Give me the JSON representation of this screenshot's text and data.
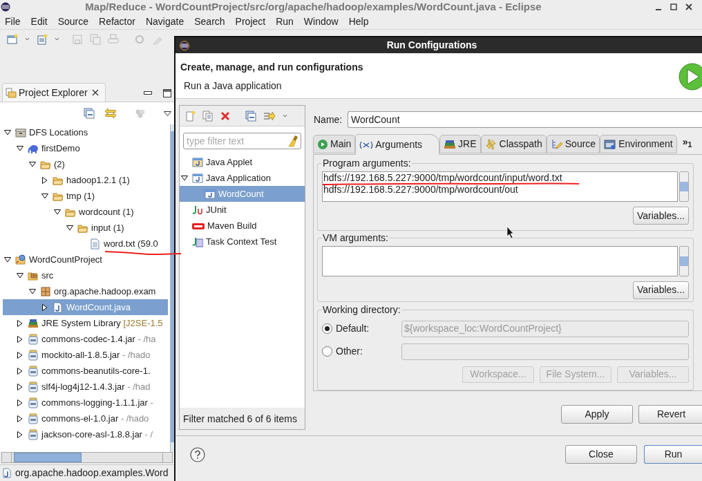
{
  "window": {
    "title": "Map/Reduce - WordCountProject/src/org/apache/hadoop/examples/WordCount.java - Eclipse"
  },
  "menu": [
    "File",
    "Edit",
    "Source",
    "Refactor",
    "Navigate",
    "Search",
    "Project",
    "Run",
    "Window",
    "Help"
  ],
  "project_explorer": {
    "title": "Project Explorer",
    "tree": [
      {
        "label": "DFS Locations",
        "kind": "dfs",
        "expanded": true,
        "selected": false,
        "children": [
          {
            "label": "firstDemo",
            "kind": "hadoop",
            "expanded": true,
            "selected": false,
            "children": [
              {
                "label": "(2)",
                "kind": "folder",
                "expanded": true,
                "selected": false,
                "children": [
                  {
                    "label": "hadoop1.2.1 (1)",
                    "kind": "folder",
                    "expanded": false,
                    "selected": false
                  },
                  {
                    "label": "tmp (1)",
                    "kind": "folder",
                    "expanded": true,
                    "selected": false,
                    "children": [
                      {
                        "label": "wordcount (1)",
                        "kind": "folder",
                        "expanded": true,
                        "selected": false,
                        "children": [
                          {
                            "label": "input (1)",
                            "kind": "folder",
                            "expanded": true,
                            "selected": false,
                            "children": [
                              {
                                "label": "word.txt (59.0",
                                "kind": "file",
                                "selected": false
                              }
                            ]
                          }
                        ]
                      }
                    ]
                  }
                ]
              }
            ]
          }
        ]
      },
      {
        "label": "WordCountProject",
        "kind": "project",
        "expanded": true,
        "selected": false,
        "children": [
          {
            "label": "src",
            "kind": "source-folder",
            "expanded": true,
            "selected": false,
            "children": [
              {
                "label": "org.apache.hadoop.exam",
                "kind": "package",
                "expanded": true,
                "selected": false,
                "children": [
                  {
                    "label": "WordCount.java",
                    "kind": "java",
                    "expanded": false,
                    "selected": true
                  }
                ]
              }
            ]
          },
          {
            "label": "JRE System Library",
            "suffix": " [J2SE-1.5",
            "kind": "library",
            "expanded": false,
            "selected": false
          },
          {
            "label": "commons-codec-1.4.jar",
            "suffix": " - /ha",
            "kind": "jar",
            "expanded": false,
            "selected": false
          },
          {
            "label": "mockito-all-1.8.5.jar",
            "suffix": " - /hado",
            "kind": "jar",
            "expanded": false,
            "selected": false
          },
          {
            "label": "commons-beanutils-core-1.",
            "kind": "jar",
            "expanded": false,
            "selected": false
          },
          {
            "label": "slf4j-log4j12-1.4.3.jar",
            "suffix": " - /had",
            "kind": "jar",
            "expanded": false,
            "selected": false
          },
          {
            "label": "commons-logging-1.1.1.jar",
            "suffix": " -",
            "kind": "jar",
            "expanded": false,
            "selected": false
          },
          {
            "label": "commons-el-1.0.jar",
            "suffix": " - /hado",
            "kind": "jar",
            "expanded": false,
            "selected": false
          },
          {
            "label": "jackson-core-asl-1.8.8.jar",
            "suffix": " - /",
            "kind": "jar",
            "expanded": false,
            "selected": false
          }
        ]
      }
    ]
  },
  "status_bar": {
    "text": "org.apache.hadoop.examples.Word"
  },
  "dialog": {
    "title": "Run Configurations",
    "heading": "Create, manage, and run configurations",
    "subheading": "Run a Java application",
    "filter": {
      "placeholder": "type filter text"
    },
    "config_tree": [
      {
        "label": "Java Applet",
        "kind": "applet",
        "selected": false
      },
      {
        "label": "Java Application",
        "kind": "application",
        "expanded": true,
        "selected": false,
        "children": [
          {
            "label": "WordCount",
            "kind": "application",
            "selected": true
          }
        ]
      },
      {
        "label": "JUnit",
        "kind": "junit",
        "selected": false
      },
      {
        "label": "Maven Build",
        "kind": "maven",
        "selected": false
      },
      {
        "label": "Task Context Test",
        "kind": "task",
        "selected": false
      }
    ],
    "filter_status": "Filter matched 6 of 6 items",
    "name_label": "Name:",
    "name_value": "WordCount",
    "tabs": [
      {
        "label": "Main",
        "kind": "main",
        "selected": false
      },
      {
        "label": "Arguments",
        "kind": "arguments",
        "selected": true
      },
      {
        "label": "JRE",
        "kind": "jre",
        "selected": false
      },
      {
        "label": "Classpath",
        "kind": "classpath",
        "selected": false
      },
      {
        "label": "Source",
        "kind": "source",
        "selected": false
      },
      {
        "label": "Environment",
        "kind": "environment",
        "selected": false
      }
    ],
    "tabs_overflow": "»$_{1}$",
    "program_arguments": {
      "label": "Program arguments:",
      "lines": [
        "hdfs://192.168.5.227:9000/tmp/wordcount/input/word.txt",
        "hdfs://192.168.5.227:9000/tmp/wordcount/out"
      ],
      "button": "Variables..."
    },
    "vm_arguments": {
      "label": "VM arguments:",
      "button": "Variables..."
    },
    "working_directory": {
      "label": "Working directory:",
      "options": [
        {
          "label": "Default:",
          "selected": true,
          "value": "${workspace_loc:WordCountProject}"
        },
        {
          "label": "Other:",
          "selected": false
        }
      ],
      "buttons": [
        {
          "label": "Workspace...",
          "disabled": true
        },
        {
          "label": "File System...",
          "disabled": true
        },
        {
          "label": "Variables...",
          "disabled": true
        }
      ]
    },
    "apply": "Apply",
    "revert": "Revert",
    "close": "Close",
    "run": "Run"
  }
}
